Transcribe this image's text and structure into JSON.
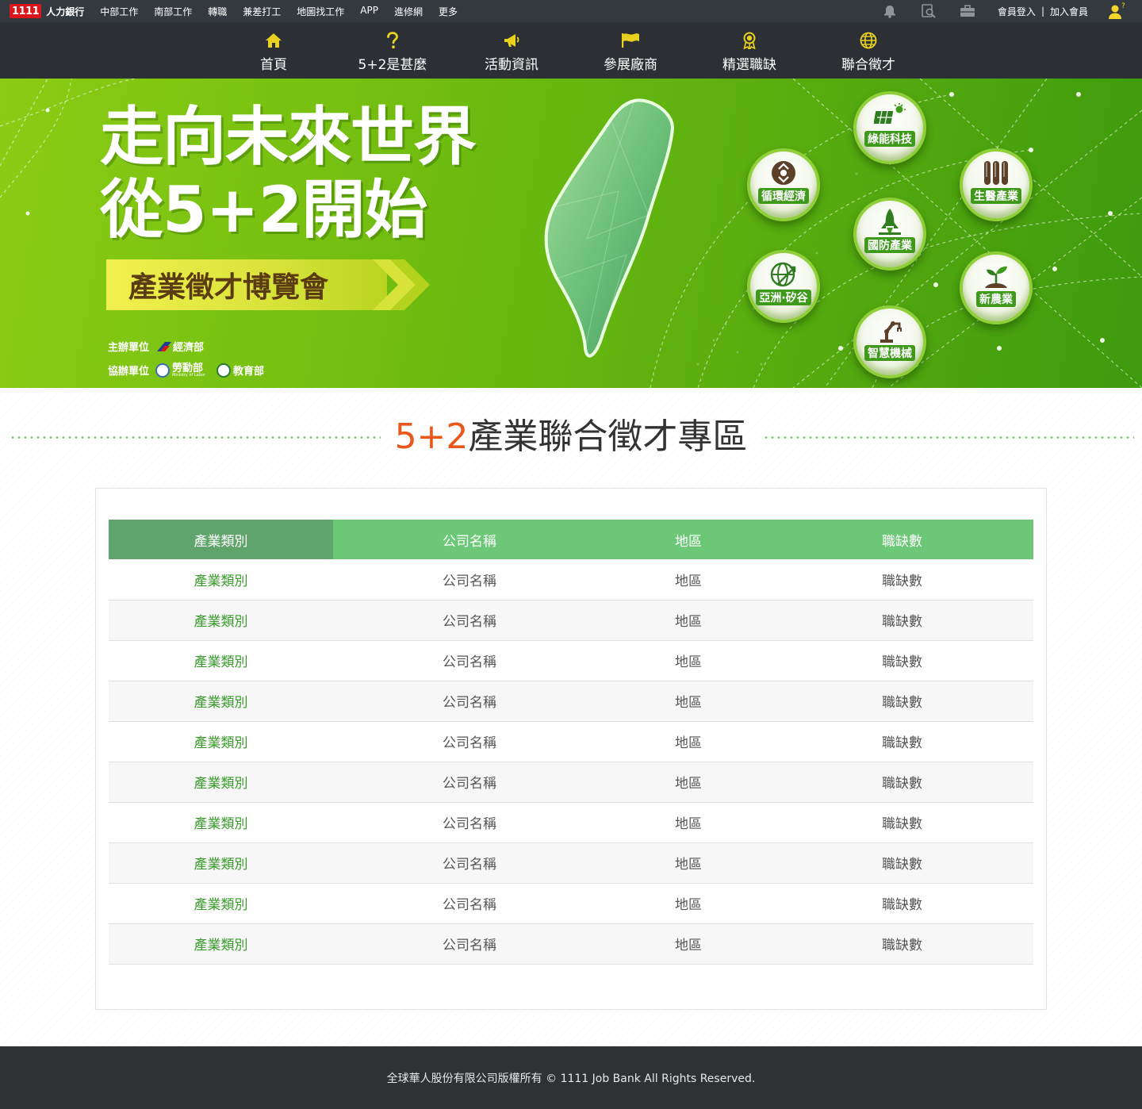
{
  "topbar": {
    "brand_logo": "1111",
    "brand_name": "人力銀行",
    "links": [
      "中部工作",
      "南部工作",
      "轉職",
      "兼差打工",
      "地圖找工作",
      "APP",
      "進修網",
      "更多"
    ],
    "icons": [
      "bell-icon",
      "search-doc-icon",
      "briefcase-icon"
    ],
    "login": "會員登入",
    "separator": "|",
    "join": "加入會員",
    "avatar_icon": "user-help-icon"
  },
  "nav": {
    "items": [
      {
        "label": "首頁",
        "icon": "home-icon"
      },
      {
        "label": "5+2是甚麼",
        "icon": "question-icon"
      },
      {
        "label": "活動資訊",
        "icon": "megaphone-icon"
      },
      {
        "label": "參展廠商",
        "icon": "flag-icon"
      },
      {
        "label": "精選職缺",
        "icon": "award-icon"
      },
      {
        "label": "聯合徵才",
        "icon": "globe-icon"
      }
    ],
    "icon_color": "#e9d21f"
  },
  "banner": {
    "title_line1": "走向未來世界",
    "title_line2": "從5+2開始",
    "expo": "產業徵才博覽會",
    "host_label": "主辦單位",
    "host_org": "經濟部",
    "co_label": "協辦單位",
    "co_org1": "勞動部",
    "co_org1_sub": "Ministry of Labor",
    "co_org2": "教育部",
    "industries": [
      {
        "label": "綠能科技",
        "icon": "solar-panel-icon"
      },
      {
        "label": "生醫產業",
        "icon": "test-tubes-icon"
      },
      {
        "label": "循環經濟",
        "icon": "recycle-icon"
      },
      {
        "label": "國防產業",
        "icon": "rocket-icon"
      },
      {
        "label": "亞洲·矽谷",
        "icon": "globe-arrow-icon"
      },
      {
        "label": "新農業",
        "icon": "sprout-icon"
      },
      {
        "label": "智慧機械",
        "icon": "robot-arm-icon"
      }
    ]
  },
  "section": {
    "title_accent": "5+2",
    "title_rest": "產業聯合徵才專區"
  },
  "table": {
    "headers": [
      "產業類別",
      "公司名稱",
      "地區",
      "職缺數"
    ],
    "rows": [
      [
        "產業類別",
        "公司名稱",
        "地區",
        "職缺數"
      ],
      [
        "產業類別",
        "公司名稱",
        "地區",
        "職缺數"
      ],
      [
        "產業類別",
        "公司名稱",
        "地區",
        "職缺數"
      ],
      [
        "產業類別",
        "公司名稱",
        "地區",
        "職缺數"
      ],
      [
        "產業類別",
        "公司名稱",
        "地區",
        "職缺數"
      ],
      [
        "產業類別",
        "公司名稱",
        "地區",
        "職缺數"
      ],
      [
        "產業類別",
        "公司名稱",
        "地區",
        "職缺數"
      ],
      [
        "產業類別",
        "公司名稱",
        "地區",
        "職缺數"
      ],
      [
        "產業類別",
        "公司名稱",
        "地區",
        "職缺數"
      ],
      [
        "產業類別",
        "公司名稱",
        "地區",
        "職缺數"
      ]
    ]
  },
  "footer": {
    "copyright": "全球華人股份有限公司版權所有 © 1111 Job Bank All Rights Reserved."
  },
  "colors": {
    "accent": "#e8571b",
    "header_green": "#6cc877",
    "category_green": "#3a9a2c",
    "banner_green": "#6ab90f"
  }
}
